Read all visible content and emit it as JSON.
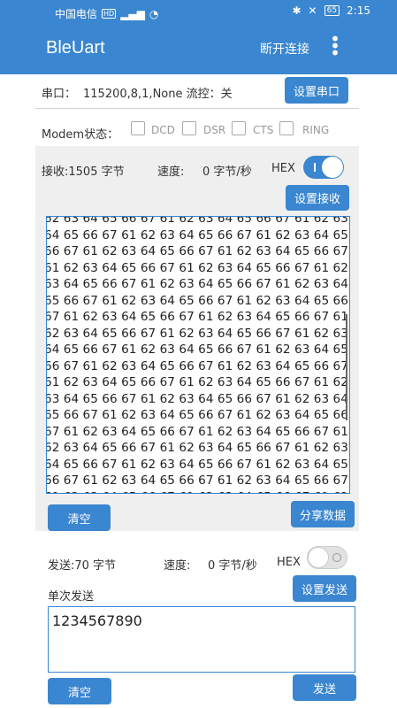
{
  "status_bar": {
    "carrier": "中国电信",
    "hd": "HD",
    "battery": "65",
    "time": "2:15"
  },
  "app_bar": {
    "title": "BleUart",
    "action": "断开连接",
    "overflow": "⋮"
  },
  "serial": {
    "label": "串口：",
    "value": "115200,8,1,None 流控：关",
    "button": "设置串口"
  },
  "modem": {
    "label": "Modem状态：",
    "signals": [
      "DCD",
      "DSR",
      "CTS",
      "RING"
    ]
  },
  "receive": {
    "count_label": "接收:1505 字节",
    "speed_label": "速度:",
    "speed_value": "0 字节/秒",
    "hex_label": "HEX",
    "hex_on": true,
    "settings_button": "设置接收",
    "text": "62 63 64 65 66 67 61 62 63 64 65 66 67 61 62 63 64 65 66 67 61 62 63 64 65 66 67 61 62 63 64 65 66 67 61 62 63 64 65 66 67 61 62 63 64 65 66 67 61 62 63 64 65 66 67 61 62 63 64 65 66 67 61 62 63 64 65 66 67 61 62 63 64 65 66 67 61 62 63 64 65 66 67 61 62 63 64 65 66 67 61 62 63 64 65 66 67 61 62 63 64 65 66 67 61 62 63 64 65 66 67 61 62 63 64 65 66 67 61 62 63 64 65 66 67 61 62 63 64 65 66 67 61 62 63 64 65 66 67 61 62 63 64 65 66 67 61 62 63 64 65 66 67 61 62 63 64 65 66 67 61 62 63 64 65 66 67 61 62 63 64 65 66 67 61 62 63 64 65 66 67 61 62 63 64 65 66 67 61 62 63 64 65 66 67 61 62 63 64 65 66 67 61 62 63 64 65 66 67 61 62 63 64 65 66 67 61 62 63 64 65 66 67 61 62 63 64 65 66 67 61 62 63 64 65 66 67 61 62 63 64 65 66 67 61 62 63 64 65 66 67 61 62 63 64 65 66 67 61 62 63 64 65 66 67 61 62 63 64 65 66 67 61 62 63 64 65 66 67 61 62 63 64 65 66 67 61 62 63 64 65 66 67 61 62 63 64 65 66 67 61 62 63 64 65 66 67 61 62 63 64 65 66 67 61 62 63 64 65 66 67 61 62 63 64 65 66 67 61 62 63 64 65 66 67 61 62 63 64 65 66 67 61 62 63 64 65 66 67 61 62 63 64 65 66 67 61 62 63 64 65 66 67 61 62 63 64 65 66 67 61 62 63 64 65 66 67 61 62 63 64 65 66 67 61 62 63 64 65 66 67 61 62 63 64 65 66 67 61 62 63 64 65 66 67 61 62 63 64 65 66 67 61 62 63 64 65 66 67 61 62 63 64 65 66 67 61 62 63 64 65 66 67 61 62 63 64 65 66 67 61 62 63 64 65 66 67",
    "clear_button": "清空",
    "share_button": "分享数据"
  },
  "send": {
    "count_label": "发送:70 字节",
    "speed_label": "速度:",
    "speed_value": "0 字节/秒",
    "hex_label": "HEX",
    "hex_on": false,
    "mode_label": "单次发送",
    "settings_button": "设置发送",
    "input_value": "1234567890",
    "clear_button": "清空",
    "send_button": "发送"
  }
}
